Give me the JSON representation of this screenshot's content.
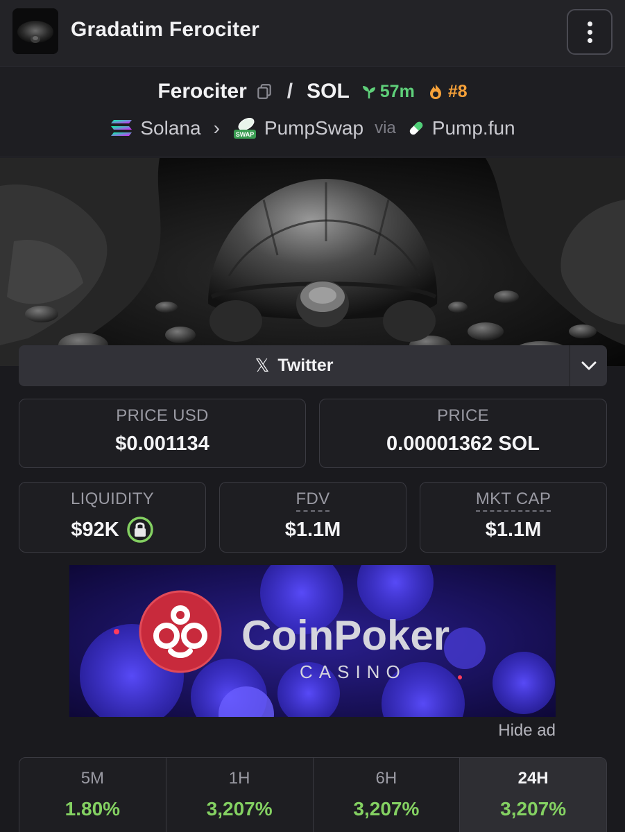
{
  "header": {
    "title": "Gradatim Ferociter"
  },
  "pair": {
    "base": "Ferociter",
    "separator": "/",
    "quote": "SOL",
    "age": "57m",
    "rank": "#8"
  },
  "chain": {
    "network": "Solana",
    "dex": "PumpSwap",
    "dex_badge": "SWAP",
    "via": "via",
    "launchpad": "Pump.fun"
  },
  "twitter": {
    "label": "Twitter"
  },
  "stats": {
    "price_usd": {
      "label": "PRICE USD",
      "value": "$0.001134"
    },
    "price": {
      "label": "PRICE",
      "value": "0.00001362 SOL"
    },
    "liquidity": {
      "label": "LIQUIDITY",
      "value": "$92K"
    },
    "fdv": {
      "label": "FDV",
      "value": "$1.1M"
    },
    "mkt_cap": {
      "label": "MKT CAP",
      "value": "$1.1M"
    }
  },
  "ad": {
    "brand": "CoinPoker",
    "sub": "CASINO",
    "hide_label": "Hide ad"
  },
  "timeframes": [
    {
      "label": "5M",
      "value": "1.80%"
    },
    {
      "label": "1H",
      "value": "3,207%"
    },
    {
      "label": "6H",
      "value": "3,207%"
    },
    {
      "label": "24H",
      "value": "3,207%",
      "active": true
    }
  ],
  "colors": {
    "positive": "#84d162",
    "age_green": "#5fd07a",
    "rank_orange": "#f7a23a"
  }
}
